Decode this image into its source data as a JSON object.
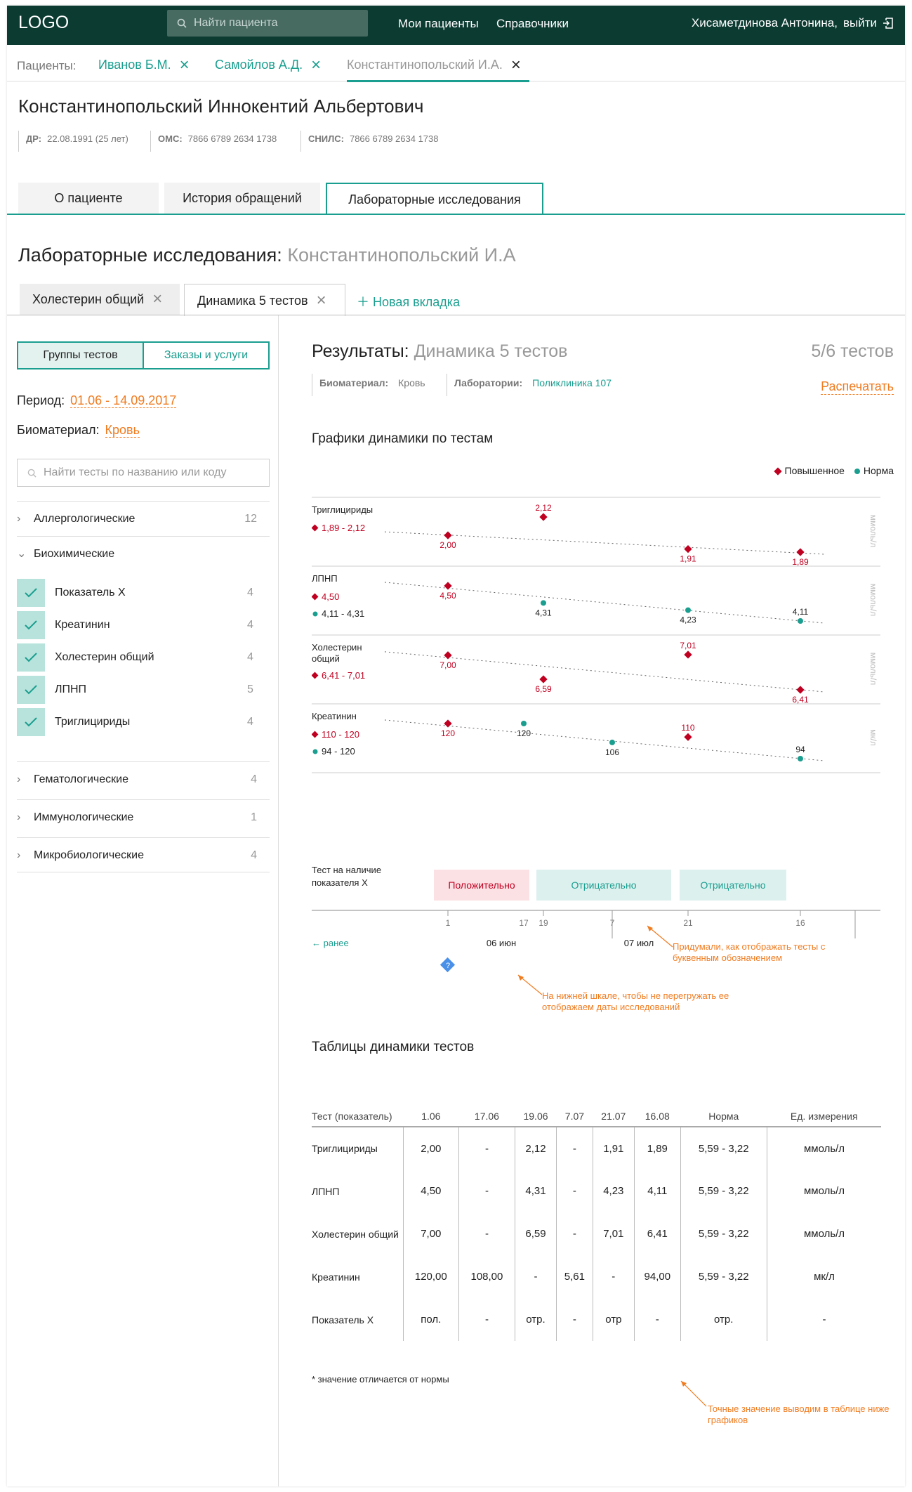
{
  "header": {
    "logo": "LOGO",
    "search_placeholder": "Найти пациента",
    "nav": [
      "Мои пациенты",
      "Справочники"
    ],
    "user": "Хисаметдинова Антонина,",
    "logout": "выйти"
  },
  "patient_tabs": {
    "label": "Пациенты:",
    "tabs": [
      "Иванов Б.М.",
      "Самойлов А.Д.",
      "Константинопольский И.А."
    ]
  },
  "patient": {
    "name": "Константинопольский Иннокентий Альбертович",
    "dob_label": "ДР:",
    "dob": "22.08.1991 (25 лет)",
    "oms_label": "ОМС:",
    "oms": "7866 6789 2634 1738",
    "snils_label": "СНИЛС:",
    "snils": "7866 6789 2634 1738"
  },
  "main_tabs": [
    "О пациенте",
    "История обращений",
    "Лабораторные исследования"
  ],
  "lab": {
    "title": "Лабораторные исследования:",
    "patient": "Константинопольский И.А",
    "subtabs": [
      "Холестерин общий",
      "Динамика 5 тестов"
    ],
    "new_tab": "Новая вкладка"
  },
  "filters": {
    "btn_groups": "Группы тестов",
    "btn_orders": "Заказы и услуги",
    "period_label": "Период:",
    "period": "01.06 - 14.09.2017",
    "bio_label": "Биоматериал:",
    "bio": "Кровь",
    "search_placeholder": "Найти тесты по названию или коду",
    "groups": [
      {
        "name": "Аллергологические",
        "count": "12"
      },
      {
        "name": "Биохимические",
        "count": ""
      },
      {
        "name": "Гематологические",
        "count": "4"
      },
      {
        "name": "Иммунологические",
        "count": "1"
      },
      {
        "name": "Микробиологические",
        "count": "4"
      }
    ],
    "items": [
      {
        "name": "Показатель X",
        "count": "4"
      },
      {
        "name": "Креатинин",
        "count": "4"
      },
      {
        "name": "Холестерин общий",
        "count": "4"
      },
      {
        "name": "ЛПНП",
        "count": "5"
      },
      {
        "name": "Триглицириды",
        "count": "4"
      }
    ]
  },
  "results": {
    "title": "Результаты:",
    "subtitle": "Динамика 5 тестов",
    "count": "5/6 тестов",
    "bio_label": "Биоматериал:",
    "bio": "Кровь",
    "lab_label": "Лаборатории:",
    "lab": "Поликлиника 107",
    "print": "Распечатать",
    "charts_title": "Графики динамики по тестам",
    "legend_high": "Повышенное",
    "legend_norm": "Норма"
  },
  "qual": {
    "label": "Тест на наличие показателя Х",
    "values": [
      "Положительно",
      "Отрицательно",
      "Отрицательно"
    ]
  },
  "axis": {
    "ticks": [
      "1",
      "17",
      "19",
      "7",
      "21",
      "16"
    ],
    "month1": "06 июн",
    "month2": "07 июл",
    "earlier": "← ранее",
    "unknown": "?"
  },
  "notes": {
    "n1": "Придумали, как отображать тесты с буквенным обозначением",
    "n2": "На нижней шкале, чтобы не перегружать ее отображаем даты исследований",
    "n3": "Точные значение выводим в таблице ниже графиков"
  },
  "table_title": "Таблицы динамики тестов",
  "table": {
    "headers": [
      "Тест (показатель)",
      "1.06",
      "17.06",
      "19.06",
      "7.07",
      "21.07",
      "16.08",
      "Норма",
      "Ед. измерения"
    ],
    "rows": [
      [
        "Триглицириды",
        "2,00",
        "-",
        "2,12",
        "-",
        "1,91",
        "1,89",
        "5,59 - 3,22",
        "ммоль/л"
      ],
      [
        "ЛПНП",
        "4,50",
        "-",
        "4,31",
        "-",
        "4,23",
        "4,11",
        "5,59 - 3,22",
        "ммоль/л"
      ],
      [
        "Холестерин общий",
        "7,00",
        "-",
        "6,59",
        "-",
        "7,01",
        "6,41",
        "5,59 - 3,22",
        "ммоль/л"
      ],
      [
        "Креатинин",
        "120,00",
        "108,00",
        "-",
        "5,61",
        "-",
        "94,00",
        "5,59 - 3,22",
        "мк/л"
      ],
      [
        "Показатель X",
        "пол.",
        "-",
        "отр.",
        "-",
        "отр",
        "-",
        "отр.",
        "-"
      ]
    ]
  },
  "footnote": "* значение отличается от нормы",
  "chart_data": {
    "type": "scatter",
    "x": [
      "1.06",
      "19.06",
      "21.07",
      "16.08"
    ],
    "series": [
      {
        "name": "Триглицириды",
        "range_high": "1,89 - 2,12",
        "range_norm": "",
        "unit": "ммоль/л",
        "points": [
          {
            "x": "1.06",
            "v": "2,00",
            "s": "high"
          },
          {
            "x": "19.06",
            "v": "2,12",
            "s": "high"
          },
          {
            "x": "21.07",
            "v": "1,91",
            "s": "high"
          },
          {
            "x": "16.08",
            "v": "1,89",
            "s": "high"
          }
        ]
      },
      {
        "name": "ЛПНП",
        "range_high": "4,50",
        "range_norm": "4,11 - 4,31",
        "unit": "ммоль/л",
        "points": [
          {
            "x": "1.06",
            "v": "4,50",
            "s": "high"
          },
          {
            "x": "19.06",
            "v": "4,31",
            "s": "norm"
          },
          {
            "x": "21.07",
            "v": "4,23",
            "s": "norm"
          },
          {
            "x": "16.08",
            "v": "4,11",
            "s": "norm"
          }
        ]
      },
      {
        "name": "Холестерин общий",
        "range_high": "6,41 - 7,01",
        "range_norm": "",
        "unit": "ммоль/л",
        "points": [
          {
            "x": "1.06",
            "v": "7,00",
            "s": "high"
          },
          {
            "x": "19.06",
            "v": "6,59",
            "s": "high"
          },
          {
            "x": "21.07",
            "v": "7,01",
            "s": "high"
          },
          {
            "x": "16.08",
            "v": "6,41",
            "s": "high"
          }
        ]
      },
      {
        "name": "Креатинин",
        "range_high": "110 - 120",
        "range_norm": "94 - 120",
        "unit": "мк/л",
        "points": [
          {
            "x": "1.06",
            "v": "120",
            "s": "high"
          },
          {
            "x": "17.06",
            "v": "120",
            "s": "norm"
          },
          {
            "x": "7.07",
            "v": "106",
            "s": "norm"
          },
          {
            "x": "21.07",
            "v": "110",
            "s": "high"
          },
          {
            "x": "16.08",
            "v": "94",
            "s": "norm"
          }
        ]
      }
    ]
  },
  "colors": {
    "accent": "#1a9e8f",
    "dark": "#0c3b32",
    "high": "#c00020",
    "orange": "#f07c21"
  }
}
